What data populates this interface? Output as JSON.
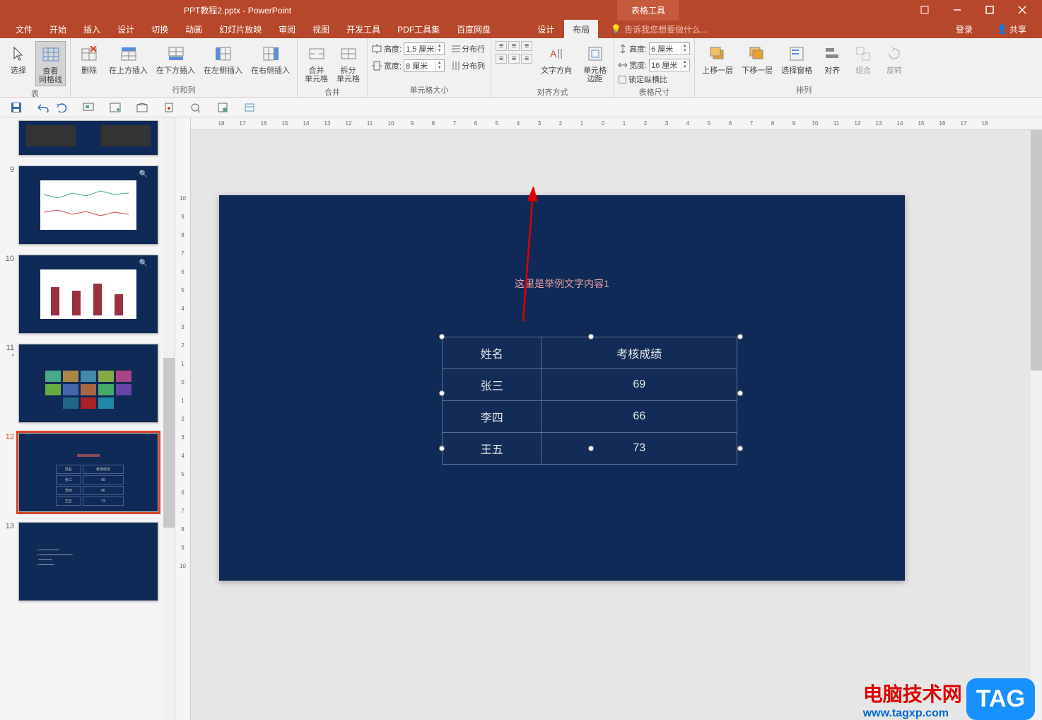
{
  "titlebar": {
    "filename": "PPT教程2.pptx - PowerPoint",
    "tools_tab": "表格工具"
  },
  "menubar": {
    "tabs": [
      "文件",
      "开始",
      "插入",
      "设计",
      "切换",
      "动画",
      "幻灯片放映",
      "审阅",
      "视图",
      "开发工具",
      "PDF工具集",
      "百度网盘"
    ],
    "tools_tabs": [
      "设计",
      "布局"
    ],
    "tellme": "告诉我您想要做什么...",
    "login": "登录",
    "share": "共享"
  },
  "ribbon": {
    "table": {
      "select": "选择",
      "gridlines": "查看\n网格线",
      "label": "表"
    },
    "rows": {
      "delete": "删除",
      "above": "在上方插入",
      "below": "在下方插入",
      "left": "在左侧插入",
      "right": "在右侧插入",
      "label": "行和列"
    },
    "merge": {
      "merge": "合并\n单元格",
      "split": "拆分\n单元格",
      "label": "合并"
    },
    "cellsize": {
      "height_lbl": "高度:",
      "height_val": "1.5 厘米",
      "width_lbl": "宽度:",
      "width_val": "8 厘米",
      "dist_rows": "分布行",
      "dist_cols": "分布列",
      "label": "单元格大小"
    },
    "align": {
      "text_dir": "文字方向",
      "margins": "单元格\n边距",
      "label": "对齐方式"
    },
    "tablesize": {
      "height_lbl": "高度:",
      "height_val": "6 厘米",
      "width_lbl": "宽度:",
      "width_val": "16 厘米",
      "lock": "锁定纵横比",
      "label": "表格尺寸"
    },
    "arrange": {
      "forward": "上移一层",
      "backward": "下移一层",
      "selpane": "选择窗格",
      "align": "对齐",
      "group": "组合",
      "rotate": "旋转",
      "label": "排列"
    }
  },
  "ruler_h": [
    "18",
    "17",
    "16",
    "15",
    "14",
    "13",
    "12",
    "11",
    "10",
    "9",
    "8",
    "7",
    "6",
    "5",
    "4",
    "3",
    "2",
    "1",
    "0",
    "1",
    "2",
    "3",
    "4",
    "5",
    "6",
    "7",
    "8",
    "9",
    "10",
    "11",
    "12",
    "13",
    "14",
    "15",
    "16",
    "17",
    "18"
  ],
  "ruler_v": [
    "10",
    "9",
    "8",
    "7",
    "6",
    "5",
    "4",
    "3",
    "2",
    "1",
    "0",
    "1",
    "2",
    "3",
    "4",
    "5",
    "6",
    "7",
    "8",
    "9",
    "10"
  ],
  "thumbs": [
    {
      "num": "9"
    },
    {
      "num": "10"
    },
    {
      "num": "11",
      "star": "*"
    },
    {
      "num": "12"
    },
    {
      "num": "13"
    }
  ],
  "slide": {
    "title": "这里是举例文字内容1",
    "table": {
      "headers": [
        "姓名",
        "考核成绩"
      ],
      "rows": [
        [
          "张三",
          "69"
        ],
        [
          "李四",
          "66"
        ],
        [
          "王五",
          "73"
        ]
      ]
    }
  },
  "chart_data": {
    "type": "table",
    "title": "这里是举例文字内容1",
    "columns": [
      "姓名",
      "考核成绩"
    ],
    "rows": [
      {
        "姓名": "张三",
        "考核成绩": 69
      },
      {
        "姓名": "李四",
        "考核成绩": 66
      },
      {
        "姓名": "王五",
        "考核成绩": 73
      }
    ]
  },
  "watermark": {
    "cn": "电脑技术网",
    "url": "www.tagxp.com",
    "tag": "TAG"
  }
}
